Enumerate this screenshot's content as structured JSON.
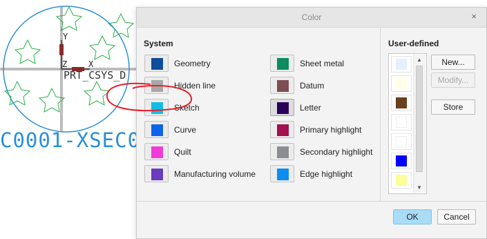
{
  "background": {
    "xsec_text": "C0001-XSEC0",
    "csys_text": "PRT_CSYS_D",
    "axis_y": "Y",
    "axis_z": "Z",
    "axis_x": "X",
    "right_fragment": ")"
  },
  "dialog": {
    "title": "Color",
    "close_icon": "×",
    "system": {
      "title": "System",
      "items": [
        {
          "label": "Geometry",
          "color": "#0f4d9c"
        },
        {
          "label": "Hidden line",
          "color": "#a7a7a7"
        },
        {
          "label": "Sketch",
          "color": "#11bde8"
        },
        {
          "label": "Curve",
          "color": "#0f63ea"
        },
        {
          "label": "Quilt",
          "color": "#f23ad8"
        },
        {
          "label": "Manufacturing volume",
          "color": "#6b3cbd"
        },
        {
          "label": "Sheet metal",
          "color": "#0b8d61"
        },
        {
          "label": "Datum",
          "color": "#7d4d55"
        },
        {
          "label": "Letter",
          "color": "#2a0059"
        },
        {
          "label": "Primary highlight",
          "color": "#a2104f"
        },
        {
          "label": "Secondary highlight",
          "color": "#8b8d91"
        },
        {
          "label": "Edge highlight",
          "color": "#0c8ef0"
        }
      ]
    },
    "user_defined": {
      "title": "User-defined",
      "colors": [
        "#e3f1ff",
        "#fffee8",
        "#6b3e1e",
        "#ffffff",
        "#ffffff",
        "#0000ff",
        "#fdfd9a"
      ],
      "new_label": "New...",
      "modify_label": "Modify...",
      "store_label": "Store"
    },
    "ok_label": "OK",
    "cancel_label": "Cancel"
  }
}
